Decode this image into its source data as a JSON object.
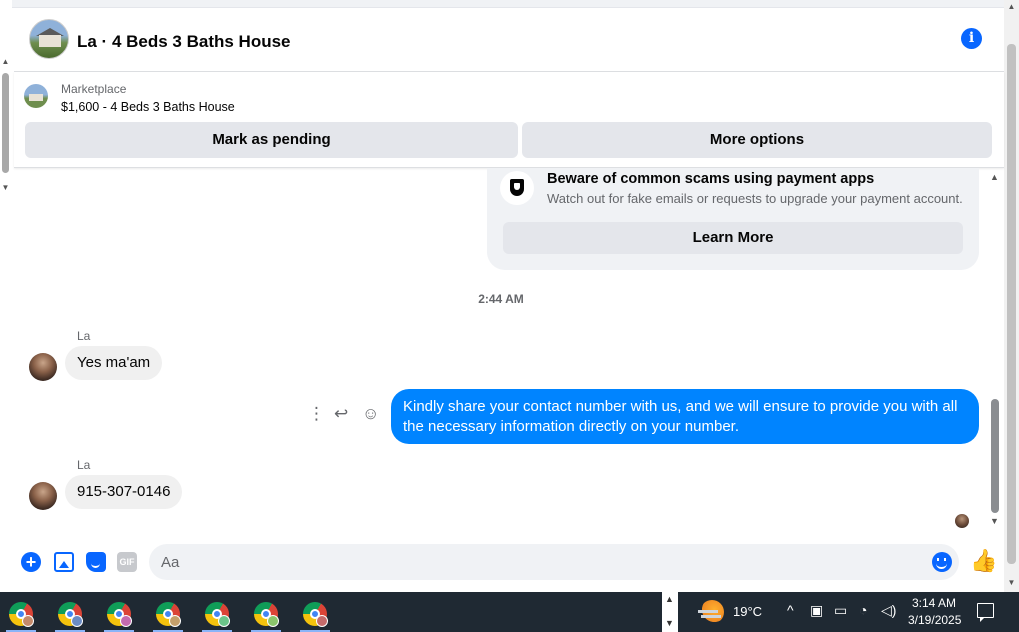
{
  "header": {
    "title": "La · 4 Beds 3 Baths House",
    "avatar_icon": "house-photo",
    "info_icon": "info-icon"
  },
  "listing": {
    "label": "Marketplace",
    "item": "$1,600 - 4 Beds 3 Baths House",
    "pending_button": "Mark as pending",
    "more_button": "More options"
  },
  "scam_notice": {
    "title": "Beware of common scams using payment apps",
    "text": "Watch out for fake emails or requests to upgrade your payment account.",
    "button": "Learn More"
  },
  "messages": {
    "timestamp": "2:44 AM",
    "m1": {
      "sender": "La",
      "text": "Yes ma'am"
    },
    "m2": {
      "text": "Kindly share your contact number with us, and we will ensure to provide you with all the necessary information directly on your number."
    },
    "m3": {
      "sender": "La",
      "text": "915-307-0146"
    }
  },
  "composer": {
    "placeholder": "Aa",
    "gif_label": "GIF"
  },
  "taskbar": {
    "temperature": "19°C",
    "time": "3:14 AM",
    "date": "3/19/2025"
  },
  "colors": {
    "accent": "#0866ff",
    "outgoing_bubble": "#0084ff",
    "incoming_bubble": "#f0f0f0",
    "taskbar": "#1f2933"
  }
}
